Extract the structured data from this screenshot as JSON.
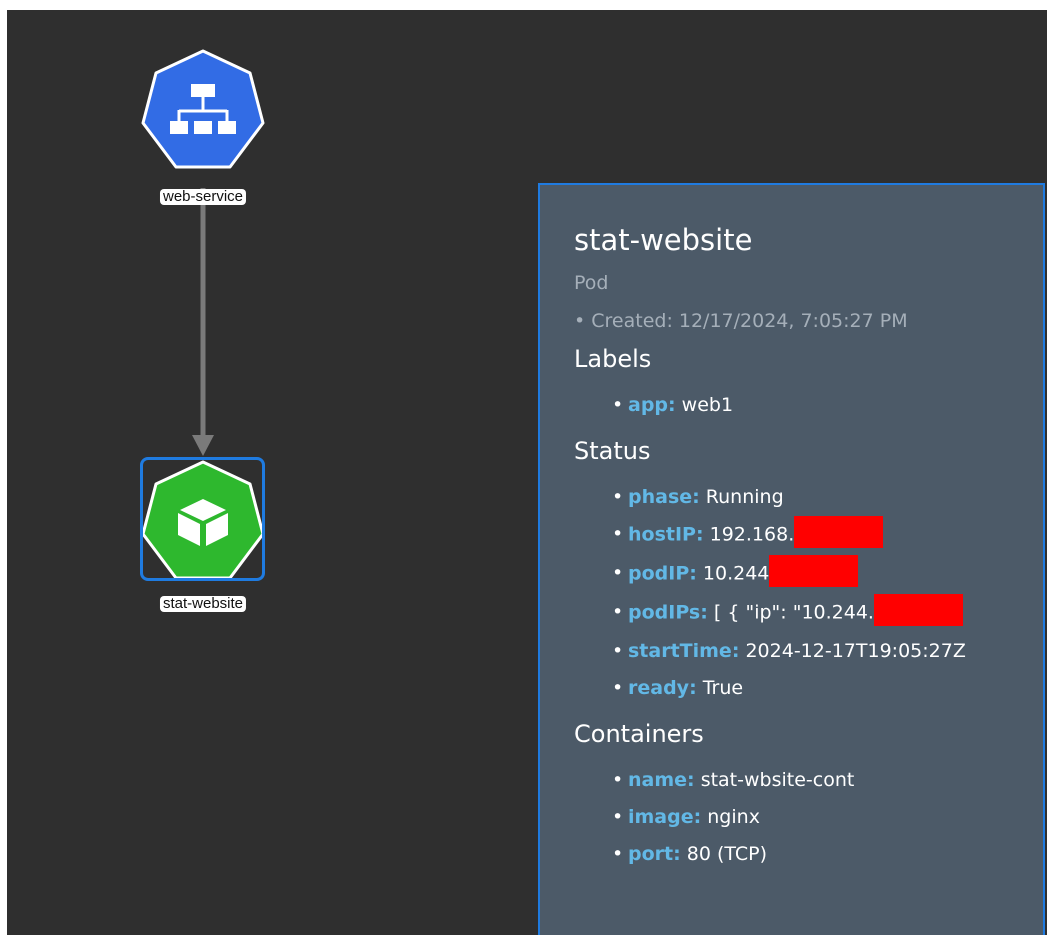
{
  "graph": {
    "service_node": {
      "label": "web-service",
      "color": "#326ce5"
    },
    "pod_node": {
      "label": "stat-website",
      "color": "#2eb82e",
      "selected": true
    },
    "edge_color": "#7a7a7a"
  },
  "panel": {
    "title": "stat-website",
    "kind": "Pod",
    "created": "• Created: 12/17/2024, 7:05:27 PM",
    "labels_heading": "Labels",
    "labels": [
      {
        "key": "app:",
        "value": "web1"
      }
    ],
    "status_heading": "Status",
    "status": [
      {
        "key": "phase:",
        "value": "Running"
      },
      {
        "key": "hostIP:",
        "value": "192.168."
      },
      {
        "key": "podIP:",
        "value": "10.244"
      },
      {
        "key": "podIPs:",
        "value": "[ { \"ip\": \"10.244."
      },
      {
        "key": "startTime:",
        "value": "2024-12-17T19:05:27Z"
      },
      {
        "key": "ready:",
        "value": "True"
      }
    ],
    "containers_heading": "Containers",
    "containers": [
      {
        "key": "name:",
        "value": "stat-wbsite-cont"
      },
      {
        "key": "image:",
        "value": "nginx"
      },
      {
        "key": "port:",
        "value": "80 (TCP)"
      }
    ]
  },
  "colors": {
    "accent": "#1f7be0",
    "key_text": "#62b8e6",
    "redaction": "#ff0000"
  }
}
